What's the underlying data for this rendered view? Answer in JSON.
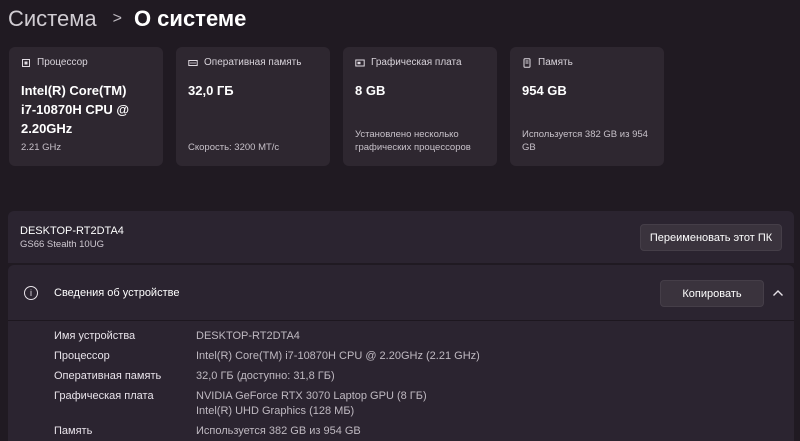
{
  "breadcrumb": {
    "parent": "Система",
    "separator": ">",
    "current": "О системе"
  },
  "cards": [
    {
      "title": "Процессор",
      "icon": "cpu-icon",
      "value": "Intel(R) Core(TM) i7-10870H CPU @ 2.20GHz",
      "value_lines": [
        "Intel(R) Core(TM)",
        "i7-10870H CPU @",
        "2.20GHz"
      ],
      "footer": "2.21 GHz"
    },
    {
      "title": "Оперативная память",
      "icon": "memory-icon",
      "value": "32,0 ГБ",
      "footer": "Скорость: 3200 МТ/с"
    },
    {
      "title": "Графическая плата",
      "icon": "gpu-icon",
      "value": "8 GB",
      "footer": "Установлено несколько графических процессоров",
      "footer_lines": [
        "Установлено несколько",
        "графических процессоров"
      ]
    },
    {
      "title": "Память",
      "icon": "storage-icon",
      "value": "954 GB",
      "footer": "Используется 382 GB из 954 GB",
      "footer_lines": [
        "Используется 382 GB из 954",
        "GB"
      ]
    }
  ],
  "pc": {
    "name": "DESKTOP-RT2DTA4",
    "model": "GS66 Stealth 10UG",
    "rename_label": "Переименовать этот ПК"
  },
  "device_specs": {
    "title": "Сведения об устройстве",
    "copy_label": "Копировать",
    "rows": [
      {
        "label": "Имя устройства",
        "value": "DESKTOP-RT2DTA4"
      },
      {
        "label": "Процессор",
        "value": "Intel(R) Core(TM) i7-10870H CPU @ 2.20GHz (2.21 GHz)"
      },
      {
        "label": "Оперативная память",
        "value": "32,0 ГБ (доступно: 31,8 ГБ)"
      },
      {
        "label": "Графическая плата",
        "value": "NVIDIA GeForce RTX 3070 Laptop GPU (8 ГБ)",
        "value2": "Intel(R) UHD Graphics (128 МБ)"
      },
      {
        "label": "Память",
        "value": "Используется 382 GB из 954 GB"
      }
    ]
  }
}
